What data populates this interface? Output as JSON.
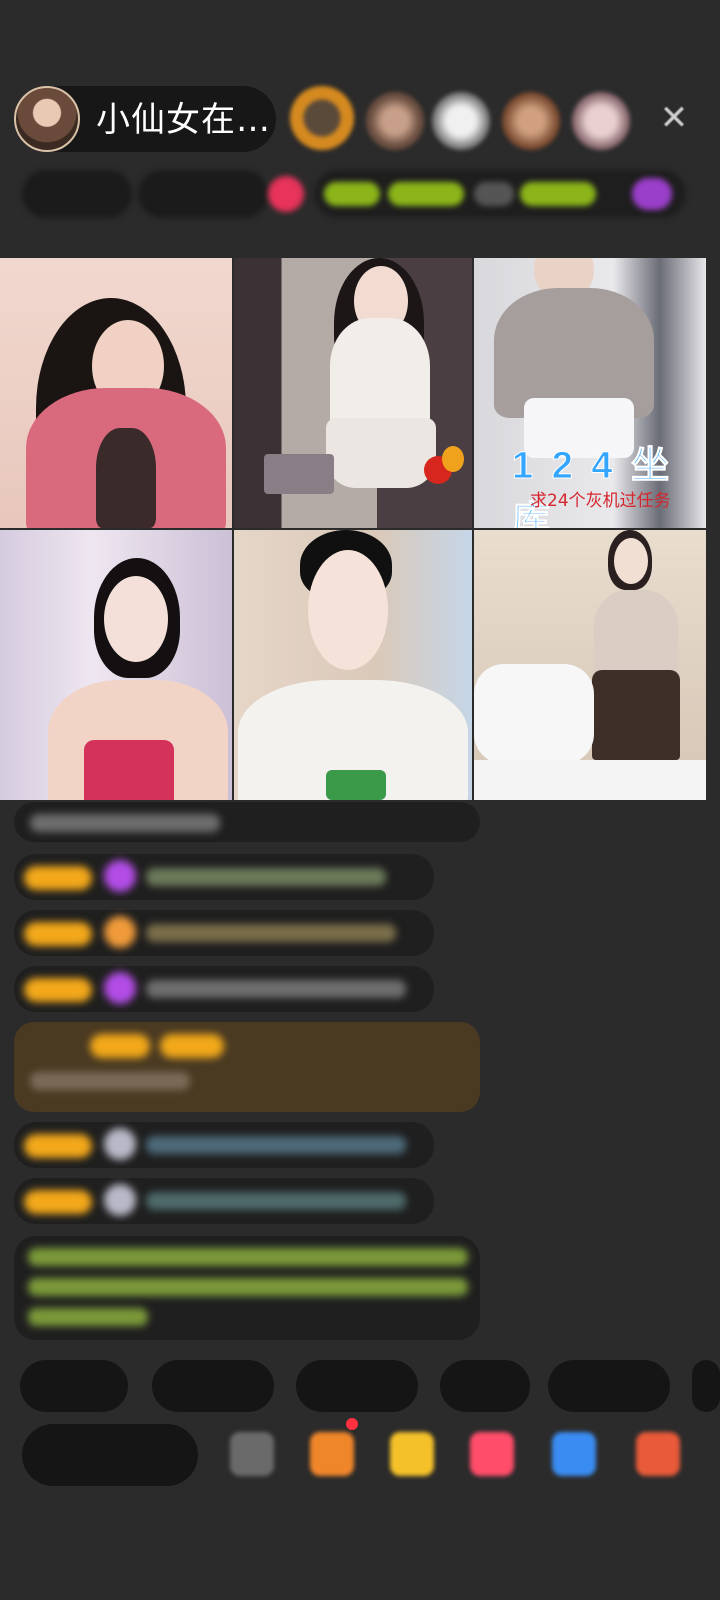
{
  "header": {
    "host_name": "小仙女在…",
    "close_icon": "close-icon"
  },
  "video_grid": {
    "cell3_overlay_number": "1 2 4 坐库",
    "cell3_overlay_task": "求24个灰机过任务"
  },
  "icons": {
    "avatar": "host-avatar",
    "gift": "gift-icon",
    "more": "more-icon"
  },
  "colors": {
    "background": "#2b2b2b",
    "level_badge": "#f2a81a",
    "diamond": "#b34de6",
    "task_text": "#d5262e",
    "overlay_number": "#34a6ff"
  }
}
